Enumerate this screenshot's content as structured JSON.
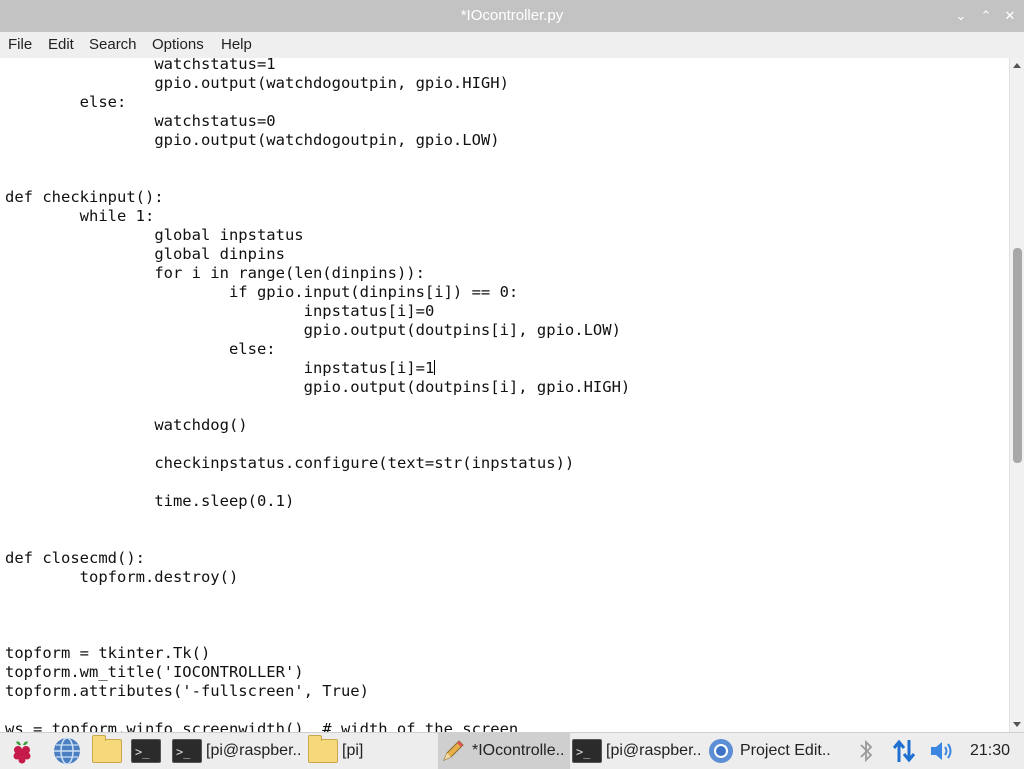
{
  "window": {
    "title": "*IOcontroller.py",
    "buttons": {
      "minimize": "⌄",
      "maximize": "⌃",
      "close": "✕"
    }
  },
  "menu": {
    "items": [
      "File",
      "Edit",
      "Search",
      "Options",
      "Help"
    ]
  },
  "editor": {
    "code_before_cursor": "\t\twatchstatus=1\n\t\tgpio.output(watchdogoutpin, gpio.HIGH)\n\telse:\n\t\twatchstatus=0\n\t\tgpio.output(watchdogoutpin, gpio.LOW)\n\n\ndef checkinput():\n\twhile 1:\n\t\tglobal inpstatus\n\t\tglobal dinpins\n\t\tfor i in range(len(dinpins)):\n\t\t\tif gpio.input(dinpins[i]) == 0:\n\t\t\t\tinpstatus[i]=0\n\t\t\t\tgpio.output(doutpins[i], gpio.LOW)\n\t\t\telse:\n\t\t\t\tinpstatus[i]=1",
    "code_after_cursor": "\n\t\t\t\tgpio.output(doutpins[i], gpio.HIGH)\n\n\t\twatchdog()\n\n\t\tcheckinpstatus.configure(text=str(inpstatus))\n\n\t\ttime.sleep(0.1)\n\n\ndef closecmd():\n\ttopform.destroy()\n\n\n\ntopform = tkinter.Tk()\ntopform.wm_title('IOCONTROLLER')\ntopform.attributes('-fullscreen', True)\n\nws = topform.winfo_screenwidth()  # width of the screen"
  },
  "taskbar": {
    "menu_icon": "raspberry-pi-icon",
    "launchers": [
      "web-browser-icon",
      "file-manager-icon",
      "terminal-icon"
    ],
    "tasks": [
      {
        "label": "[pi@raspber...",
        "icon": "terminal-icon",
        "active": false
      },
      {
        "label": "[pi]",
        "icon": "folder-icon",
        "active": false
      },
      {
        "label": "*IOcontrolle...",
        "icon": "pencil-icon",
        "active": true
      },
      {
        "label": "[pi@raspber...",
        "icon": "terminal-icon",
        "active": false
      },
      {
        "label": "Project Edit...",
        "icon": "chromium-icon",
        "active": false
      }
    ],
    "tray": [
      "bluetooth-icon",
      "network-icon",
      "volume-icon"
    ],
    "clock": "21:30"
  },
  "colors": {
    "titlebar": "#c3c3c3",
    "menubar": "#efefef",
    "taskbar": "#ededed",
    "active_task": "#cfcfcf"
  }
}
